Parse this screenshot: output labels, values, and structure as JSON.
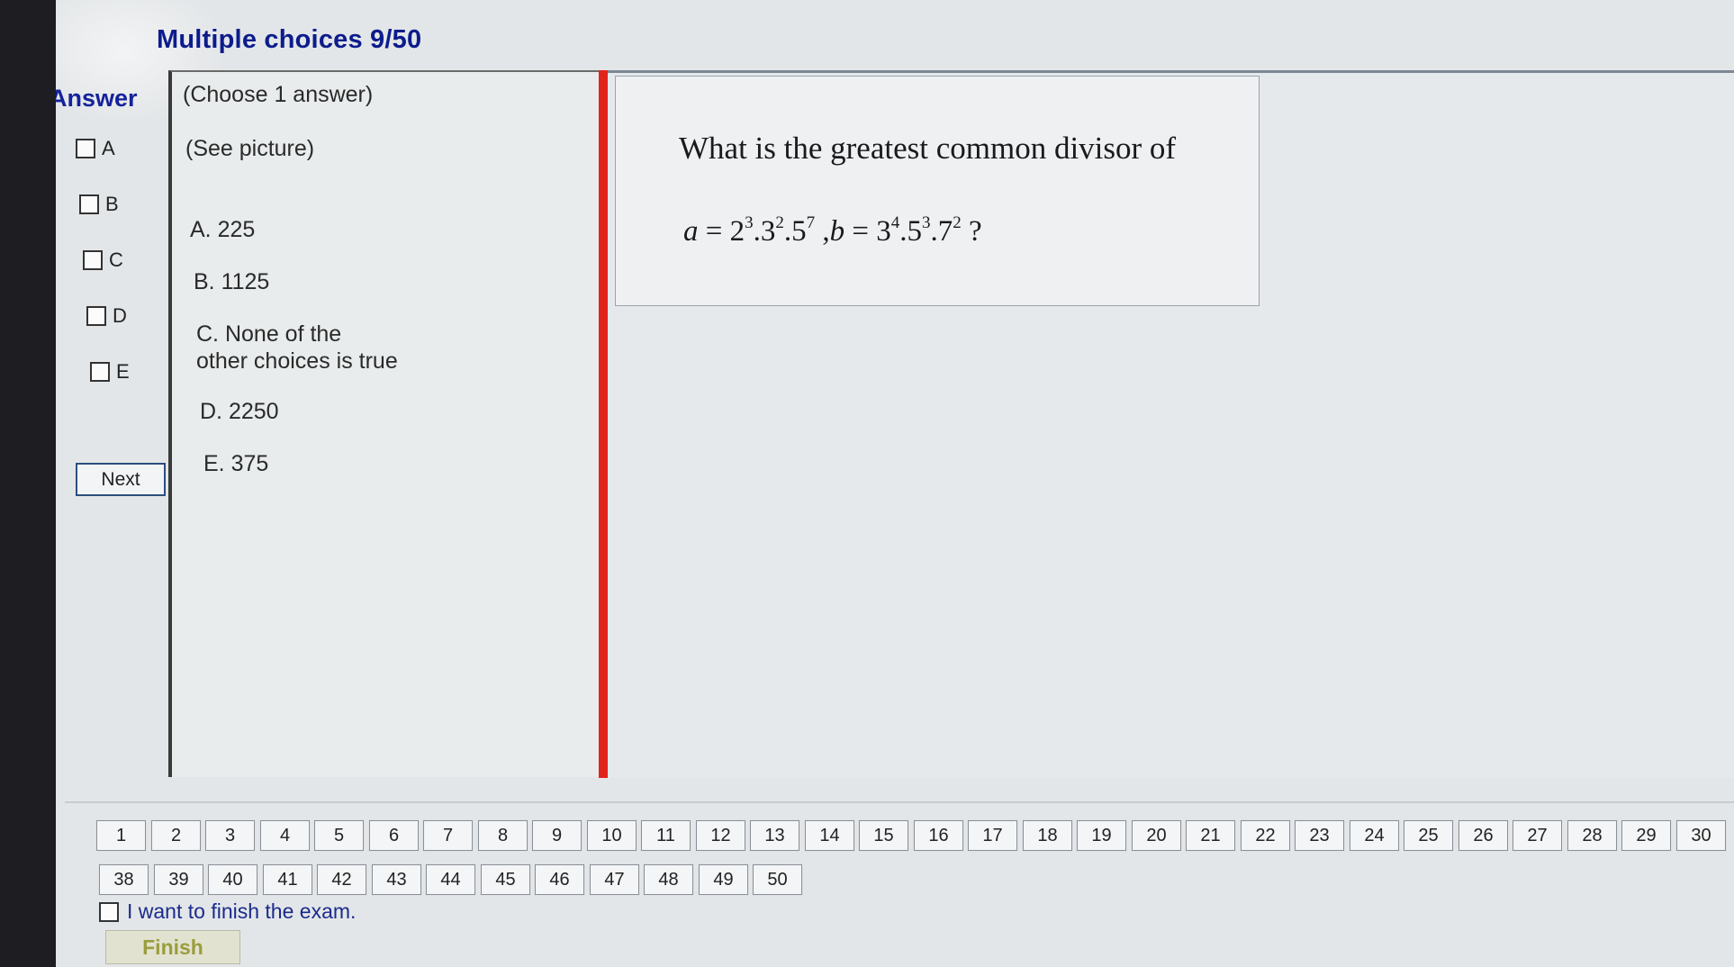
{
  "header": {
    "title": "Multiple choices 9/50"
  },
  "answer_panel": {
    "heading": "Answer",
    "options": [
      {
        "label": "A",
        "checked": false
      },
      {
        "label": "B",
        "checked": false
      },
      {
        "label": "C",
        "checked": false
      },
      {
        "label": "D",
        "checked": false
      },
      {
        "label": "E",
        "checked": false
      }
    ],
    "next_label": "Next"
  },
  "choices": {
    "instruction": "(Choose 1 answer)",
    "see_picture": "(See picture)",
    "items": [
      {
        "letter": "A.",
        "text": "225"
      },
      {
        "letter": "B.",
        "text": "1125"
      },
      {
        "letter": "C.",
        "text": "None of the",
        "text2": "other choices is true"
      },
      {
        "letter": "D.",
        "text": "2250"
      },
      {
        "letter": "E.",
        "text": "375"
      }
    ]
  },
  "question": {
    "text": "What is the greatest common divisor of",
    "formula": {
      "a_var": "a",
      "b_var": "b",
      "eq": " = ",
      "dot": ".",
      "comma": " ,",
      "end": " ?",
      "a_terms": [
        {
          "base": "2",
          "exp": "3"
        },
        {
          "base": "3",
          "exp": "2"
        },
        {
          "base": "5",
          "exp": "7"
        }
      ],
      "b_terms": [
        {
          "base": "3",
          "exp": "4"
        },
        {
          "base": "5",
          "exp": "3"
        },
        {
          "base": "7",
          "exp": "2"
        }
      ]
    }
  },
  "navigation": {
    "row1": [
      "1",
      "2",
      "3",
      "4",
      "5",
      "6",
      "7",
      "8",
      "9",
      "10",
      "11",
      "12",
      "13",
      "14",
      "15",
      "16",
      "17",
      "18",
      "19",
      "20",
      "21",
      "22",
      "23",
      "24",
      "25",
      "26",
      "27",
      "28",
      "29",
      "30"
    ],
    "row2": [
      "38",
      "39",
      "40",
      "41",
      "42",
      "43",
      "44",
      "45",
      "46",
      "47",
      "48",
      "49",
      "50"
    ]
  },
  "finish": {
    "checkbox_label": "I want to finish the exam.",
    "checked": false,
    "button_label": "Finish"
  },
  "colors": {
    "title": "#0c1c8c",
    "divider": "#e2231a",
    "finish_text": "#9a9d3c"
  }
}
